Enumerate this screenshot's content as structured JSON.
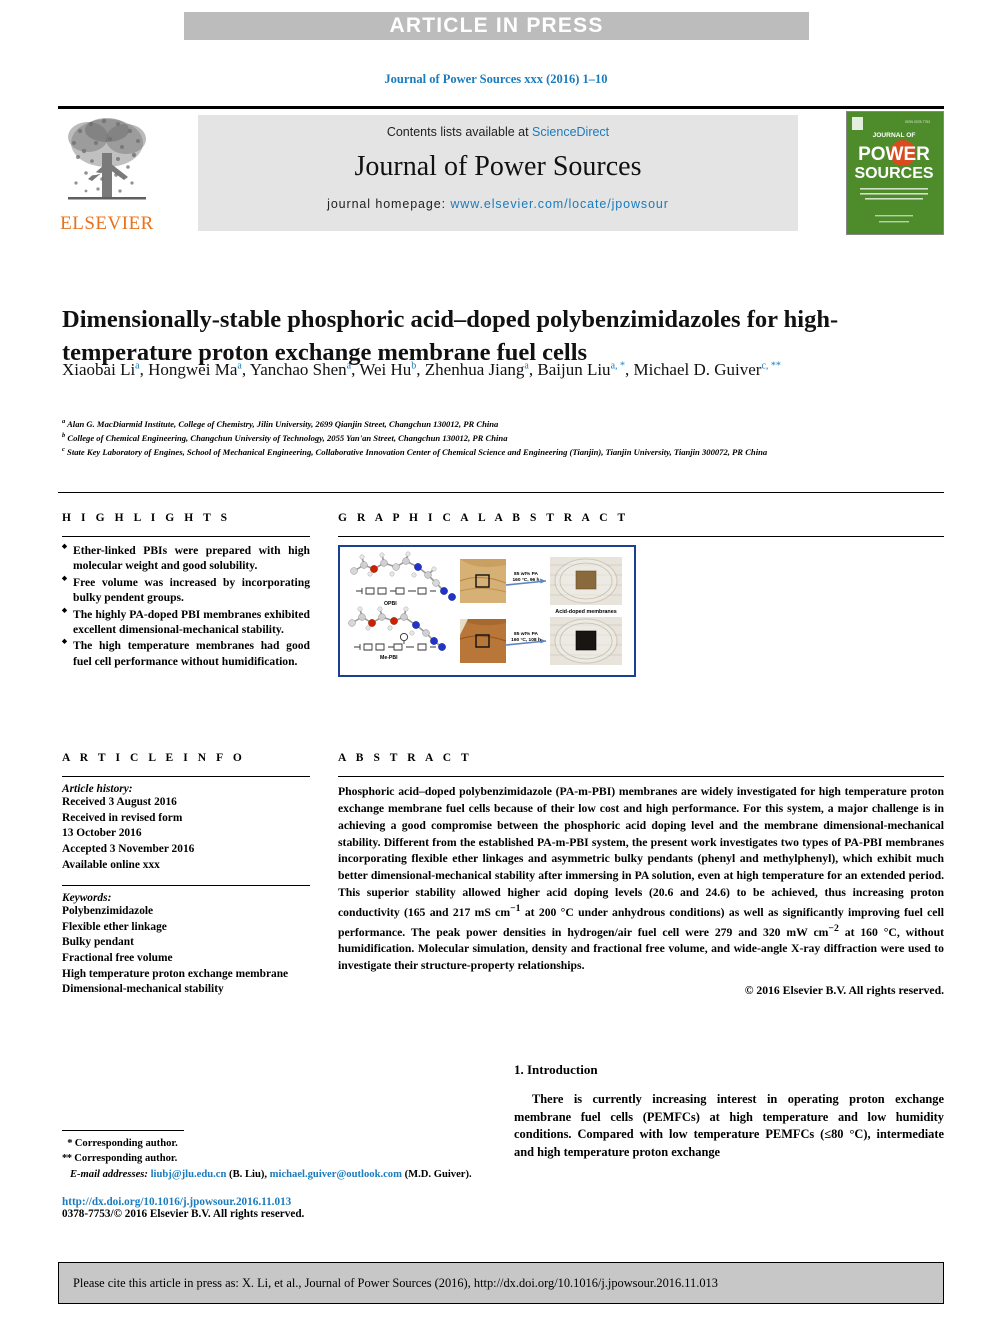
{
  "banner": {
    "text": "ARTICLE IN PRESS"
  },
  "journal_ref": "Journal of Power Sources xxx (2016) 1–10",
  "masthead": {
    "contents_prefix": "Contents lists available at ",
    "contents_link": "ScienceDirect",
    "journal_name": "Journal of Power Sources",
    "homepage_label": "journal homepage: ",
    "homepage_url": "www.elsevier.com/locate/jpowsour",
    "publisher_wordmark": "ELSEVIER",
    "cover_title_line1": "JOURNAL OF",
    "cover_title_line2": "POWER",
    "cover_title_line3": "SOURCES"
  },
  "article": {
    "title": "Dimensionally-stable phosphoric acid–doped polybenzimidazoles for high-temperature proton exchange membrane fuel cells",
    "authors": [
      {
        "name": "Xiaobai Li",
        "marks": "a"
      },
      {
        "name": "Hongwei Ma",
        "marks": "a"
      },
      {
        "name": "Yanchao Shen",
        "marks": "a"
      },
      {
        "name": "Wei Hu",
        "marks": "b"
      },
      {
        "name": "Zhenhua Jiang",
        "marks": "a"
      },
      {
        "name": "Baijun Liu",
        "marks": "a, *"
      },
      {
        "name": "Michael D. Guiver",
        "marks": "c, **"
      }
    ],
    "affiliations": [
      {
        "mark": "a",
        "text": "Alan G. MacDiarmid Institute, College of Chemistry, Jilin University, 2699 Qianjin Street, Changchun 130012, PR China"
      },
      {
        "mark": "b",
        "text": "College of Chemical Engineering, Changchun University of Technology, 2055 Yan'an Street, Changchun 130012, PR China"
      },
      {
        "mark": "c",
        "text": "State Key Laboratory of Engines, School of Mechanical Engineering, Collaborative Innovation Center of Chemical Science and Engineering (Tianjin), Tianjin University, Tianjin 300072, PR China"
      }
    ]
  },
  "highlights": {
    "heading": "H I G H L I G H T S",
    "items": [
      "Ether-linked PBIs were prepared with high molecular weight and good solubility.",
      "Free volume was increased by incorporating bulky pendent groups.",
      "The highly PA-doped PBI membranes exhibited excellent dimensional-mechanical stability.",
      "The high temperature membranes had good fuel cell performance without humidification."
    ]
  },
  "graphical_abstract": {
    "heading": "G R A P H I C A L   A B S T R A C T",
    "labels": {
      "polymer_top": "OPBI",
      "polymer_bottom": "Me-PBI",
      "arrow_top_line1": "85 wt% PA",
      "arrow_top_line2": "160 °C, 96 h",
      "arrow_bottom_line1": "85 wt% PA",
      "arrow_bottom_line2": "160 °C, 108 h",
      "result_caption": "Acid-doped membranes"
    }
  },
  "article_info": {
    "heading": "A R T I C L E   I N F O",
    "history_label": "Article history:",
    "history": [
      "Received 3 August 2016",
      "Received in revised form",
      "13 October 2016",
      "Accepted 3 November 2016",
      "Available online xxx"
    ],
    "keywords_label": "Keywords:",
    "keywords": [
      "Polybenzimidazole",
      "Flexible ether linkage",
      "Bulky pendant",
      "Fractional free volume",
      "High temperature proton exchange membrane",
      "Dimensional-mechanical stability"
    ]
  },
  "abstract": {
    "heading": "A B S T R A C T",
    "body": "Phosphoric acid–doped polybenzimidazole (PA-m-PBI) membranes are widely investigated for high temperature proton exchange membrane fuel cells because of their low cost and high performance. For this system, a major challenge is in achieving a good compromise between the phosphoric acid doping level and the membrane dimensional-mechanical stability. Different from the established PA-m-PBI system, the present work investigates two types of PA-PBI membranes incorporating flexible ether linkages and asymmetric bulky pendants (phenyl and methylphenyl), which exhibit much better dimensional-mechanical stability after immersing in PA solution, even at high temperature for an extended period. This superior stability allowed higher acid doping levels (20.6 and 24.6) to be achieved, thus increasing proton conductivity (165 and 217 mS cm−1 at 200 °C under anhydrous conditions) as well as significantly improving fuel cell performance. The peak power densities in hydrogen/air fuel cell were 279 and 320 mW cm−2 at 160 °C, without humidification. Molecular simulation, density and fractional free volume, and wide-angle X-ray diffraction were used to investigate their structure-property relationships.",
    "copyright": "© 2016 Elsevier B.V. All rights reserved."
  },
  "introduction": {
    "heading": "1. Introduction",
    "paragraph": "There is currently increasing interest in operating proton exchange membrane fuel cells (PEMFCs) at high temperature and low humidity conditions. Compared with low temperature PEMFCs (≤80 °C), intermediate and high temperature proton exchange"
  },
  "footnotes": {
    "corresponding_1": "Corresponding author.",
    "corresponding_1_mark": "*",
    "corresponding_2": "Corresponding author.",
    "corresponding_2_mark": "**",
    "email_label": "E-mail addresses:",
    "email_1": "liubj@jlu.edu.cn",
    "email_1_person": "(B. Liu),",
    "email_2": "michael.guiver@outlook.com",
    "email_2_person": "(M.D. Guiver).",
    "doi": "http://dx.doi.org/10.1016/j.jpowsour.2016.11.013",
    "issn": "0378-7753/© 2016 Elsevier B.V. All rights reserved."
  },
  "cite_box": {
    "text": "Please cite this article in press as: X. Li, et al., Journal of Power Sources (2016), http://dx.doi.org/10.1016/j.jpowsour.2016.11.013"
  }
}
